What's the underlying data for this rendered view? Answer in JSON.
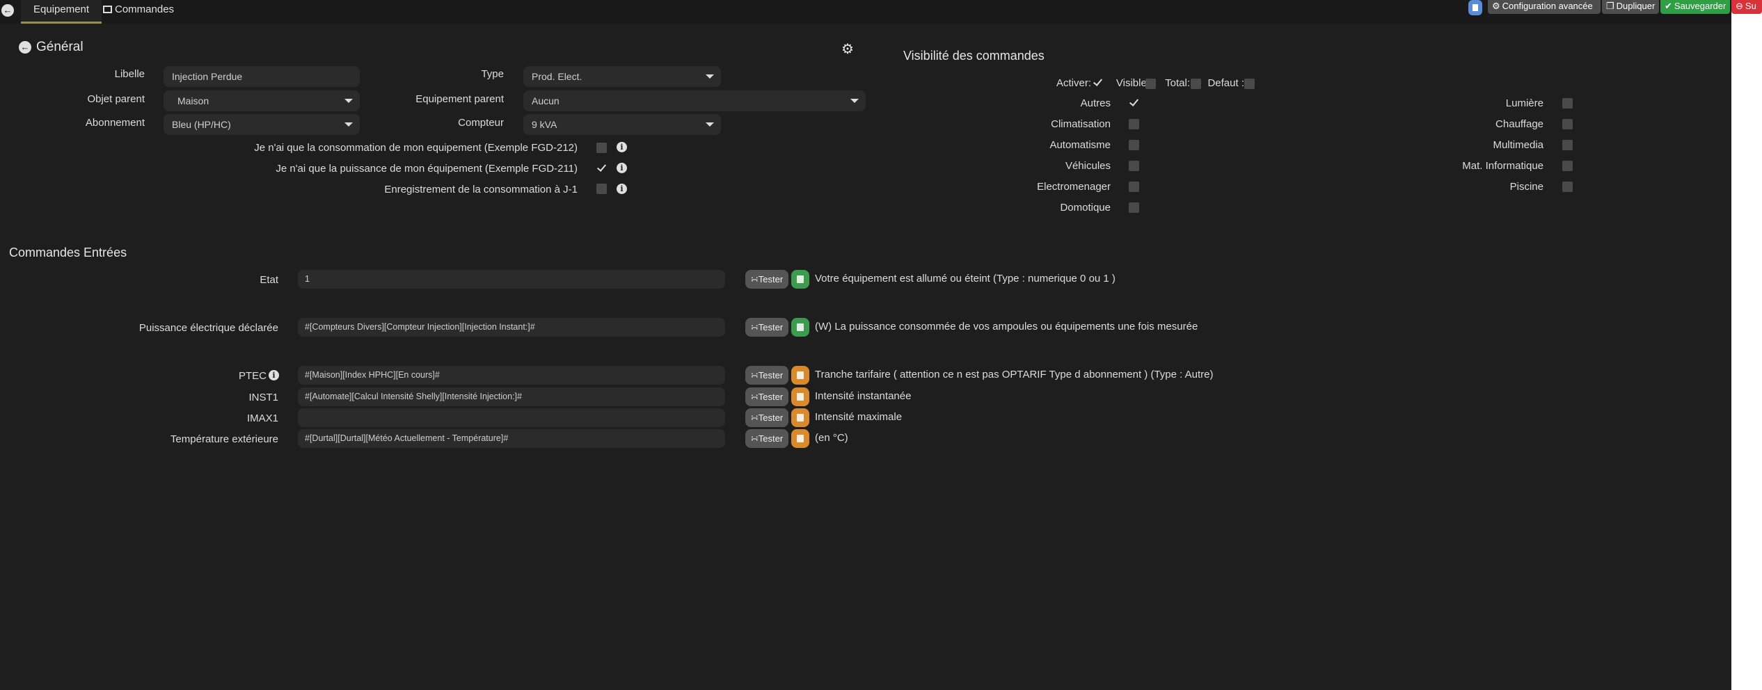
{
  "topbar": {
    "tabs": [
      {
        "label": "Equipement"
      },
      {
        "label": "Commandes"
      }
    ],
    "buttons": {
      "advanced": "Configuration avancée",
      "duplicate": "Dupliquer",
      "save": "Sauvegarder",
      "delete": "Su"
    },
    "colors": {
      "advanced": "#4d4d4d",
      "duplicate": "#4d4d4d",
      "save": "#2f9e44",
      "delete": "#d9323a",
      "doc": "#5b8dd6"
    }
  },
  "general": {
    "title": "Général",
    "libelle_label": "Libelle",
    "libelle_value": "Injection Perdue",
    "type_label": "Type",
    "type_value": "Prod. Elect.",
    "parent_object_label": "Objet parent",
    "parent_object_value": "Maison",
    "parent_equipment_label": "Equipement parent",
    "parent_equipment_value": "Aucun",
    "subscription_label": "Abonnement",
    "subscription_value": "Bleu (HP/HC)",
    "meter_label": "Compteur",
    "meter_value": "9 kVA",
    "options": [
      {
        "label": "Je n'ai que la consommation de mon equipement (Exemple FGD-212)",
        "checked": false
      },
      {
        "label": "Je n'ai que la puissance de mon équipement (Exemple FGD-211)",
        "checked": true
      },
      {
        "label": "Enregistrement de la consommation à J-1",
        "checked": false
      }
    ]
  },
  "visibility": {
    "title": "Visibilité des commandes",
    "header": {
      "activate": "Activer:",
      "visible": "Visible:",
      "total": "Total:",
      "default": "Defaut :"
    },
    "header_checked": {
      "activate": true,
      "visible": false,
      "total": false,
      "default": false
    },
    "left": [
      {
        "label": "Autres",
        "checked": true
      },
      {
        "label": "Climatisation",
        "checked": false
      },
      {
        "label": "Automatisme",
        "checked": false
      },
      {
        "label": "Véhicules",
        "checked": false
      },
      {
        "label": "Electromenager",
        "checked": false
      },
      {
        "label": "Domotique",
        "checked": false
      }
    ],
    "right": [
      {
        "label": "Lumière",
        "checked": false
      },
      {
        "label": "Chauffage",
        "checked": false
      },
      {
        "label": "Multimedia",
        "checked": false
      },
      {
        "label": "Mat. Informatique",
        "checked": false
      },
      {
        "label": "Piscine",
        "checked": false
      }
    ]
  },
  "commands": {
    "title": "Commandes Entrées",
    "tester_label": "Tester",
    "rows": [
      {
        "label": "Etat",
        "value": "1",
        "description": "Votre équipement est allumé ou éteint (Type : numerique 0 ou 1 )",
        "config_color": "green"
      },
      {
        "label": "Puissance électrique déclarée",
        "value": "#[Compteurs Divers][Compteur Injection][Injection Instant:]#",
        "description": "(W) La puissance consommée de vos ampoules ou équipements une fois mesurée",
        "config_color": "green"
      },
      {
        "label": "PTEC",
        "value": "#[Maison][Index HPHC][En cours]#",
        "description": "Tranche tarifaire ( attention ce n est pas OPTARIF Type d abonnement ) (Type : Autre)",
        "config_color": "orange",
        "info": true
      },
      {
        "label": "INST1",
        "value": "#[Automate][Calcul Intensité Shelly][Intensité Injection:]#",
        "description": "Intensité instantanée",
        "config_color": "orange"
      },
      {
        "label": "IMAX1",
        "value": "",
        "description": "Intensité maximale",
        "config_color": "orange"
      },
      {
        "label": "Température extérieure",
        "value": "#[Durtal][Durtal][Météo Actuellement - Température]#",
        "description": "(en °C)",
        "config_color": "orange"
      }
    ]
  },
  "icons": {
    "back": "arrow-left-circle-icon",
    "gears": "gears-icon",
    "rss": "rss-icon",
    "info": "info-circle-icon"
  }
}
